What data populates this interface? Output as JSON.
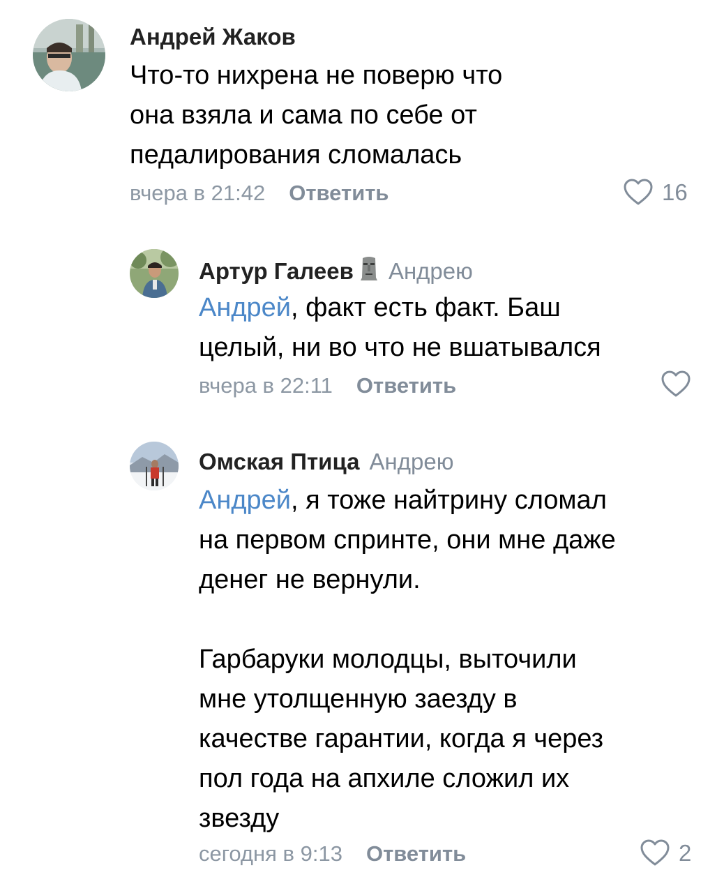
{
  "comments": [
    {
      "author": "Андрей Жаков",
      "reply_to": "",
      "text_lines": [
        "Что-то нихрена не поверю что",
        "она взяла и сама по себе от",
        "педалирования сломалась"
      ],
      "time": "вчера в 21:42",
      "reply_label": "Ответить",
      "likes": "16",
      "avatar_icon": "user-photo-avatar"
    },
    {
      "author": "Артур Галеев",
      "author_emoji": "moai-icon",
      "reply_to": "Андрею",
      "mention": "Андрей",
      "text_lines": [
        ", факт есть факт. Баш",
        "целый, ни во что не вшатывался"
      ],
      "time": "вчера в 22:11",
      "reply_label": "Ответить",
      "likes": "",
      "avatar_icon": "user-photo-avatar"
    },
    {
      "author": "Омская Птица",
      "reply_to": "Андрею",
      "mention": "Андрей",
      "text_lines": [
        ", я тоже найтрину сломал",
        "на первом спринте, они мне даже",
        "денег не вернули.",
        "",
        "Гарбаруки молодцы, выточили",
        "мне утолщенную заезду в",
        "качестве гарантии, когда я через",
        "пол года на апхиле сложил их",
        "звезду"
      ],
      "time": "сегодня в 9:13",
      "reply_label": "Ответить",
      "likes": "2",
      "avatar_icon": "user-photo-avatar"
    }
  ],
  "colors": {
    "link": "#4b87c8",
    "meta": "#8c97a3",
    "reply_button": "#818c99"
  }
}
